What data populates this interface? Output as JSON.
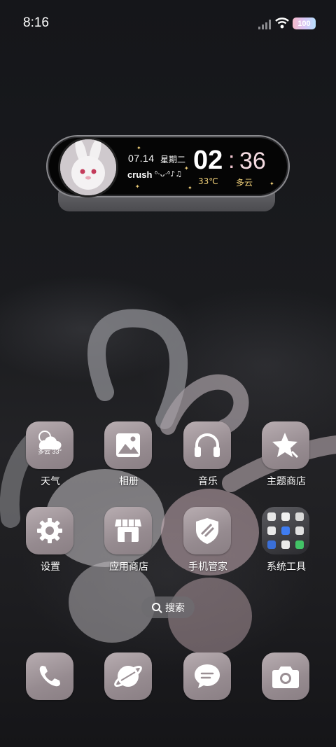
{
  "status_bar": {
    "time": "8:16",
    "battery": "100",
    "icons": [
      "signal-icon",
      "wifi-icon",
      "battery-icon"
    ]
  },
  "widget": {
    "date": "07.14",
    "weekday": "星期二",
    "caption": "crush",
    "caption_deco": "ᵟ·ᴗ·ᵟ♪♫",
    "hour": "02",
    "colon": ":",
    "minute": "36",
    "temperature": "33℃",
    "condition": "多云",
    "accent_color": "#f3d27a"
  },
  "apps": [
    {
      "label": "天气",
      "icon": "weather-icon",
      "badge": "多云 33°"
    },
    {
      "label": "相册",
      "icon": "gallery-icon"
    },
    {
      "label": "音乐",
      "icon": "headphones-icon"
    },
    {
      "label": "主题商店",
      "icon": "theme-star-icon"
    },
    {
      "label": "设置",
      "icon": "gear-icon"
    },
    {
      "label": "应用商店",
      "icon": "store-icon"
    },
    {
      "label": "手机管家",
      "icon": "shield-icon"
    },
    {
      "label": "系统工具",
      "icon": "folder-icon"
    }
  ],
  "search": {
    "label": "搜索",
    "icon": "search-icon"
  },
  "dock": [
    {
      "icon": "phone-icon"
    },
    {
      "icon": "browser-icon"
    },
    {
      "icon": "message-icon"
    },
    {
      "icon": "camera-icon"
    }
  ],
  "tile_color": "#a0959a"
}
